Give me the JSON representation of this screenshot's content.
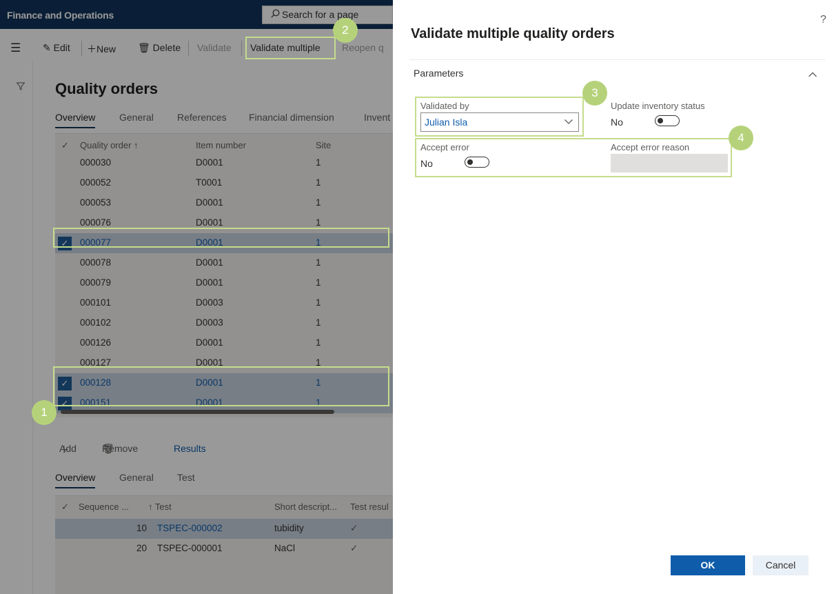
{
  "app": {
    "title": "Finance and Operations",
    "search_placeholder": "Search for a page"
  },
  "action_pane": {
    "edit": "Edit",
    "new": "New",
    "delete": "Delete",
    "validate": "Validate",
    "validate_multiple": "Validate multiple",
    "reopen": "Reopen q"
  },
  "page": {
    "title": "Quality orders",
    "tabs": [
      "Overview",
      "General",
      "References",
      "Financial dimension",
      "Invent"
    ]
  },
  "orders_grid": {
    "columns": [
      "Quality order ↑",
      "Item number",
      "Site"
    ],
    "rows": [
      {
        "order": "000030",
        "item": "D0001",
        "site": "1",
        "selected": false
      },
      {
        "order": "000052",
        "item": "T0001",
        "site": "1",
        "selected": false
      },
      {
        "order": "000053",
        "item": "D0001",
        "site": "1",
        "selected": false
      },
      {
        "order": "000076",
        "item": "D0001",
        "site": "1",
        "selected": false
      },
      {
        "order": "000077",
        "item": "D0001",
        "site": "1",
        "selected": true
      },
      {
        "order": "000078",
        "item": "D0001",
        "site": "1",
        "selected": false
      },
      {
        "order": "000079",
        "item": "D0001",
        "site": "1",
        "selected": false
      },
      {
        "order": "000101",
        "item": "D0003",
        "site": "1",
        "selected": false
      },
      {
        "order": "000102",
        "item": "D0003",
        "site": "1",
        "selected": false
      },
      {
        "order": "000126",
        "item": "D0001",
        "site": "1",
        "selected": false
      },
      {
        "order": "000127",
        "item": "D0001",
        "site": "1",
        "selected": false
      },
      {
        "order": "000128",
        "item": "D0001",
        "site": "1",
        "selected": true
      },
      {
        "order": "000151",
        "item": "D0001",
        "site": "1",
        "selected": true
      }
    ]
  },
  "lines_actions": {
    "add": "Add",
    "remove": "Remove",
    "results": "Results"
  },
  "lines_tabs": [
    "Overview",
    "General",
    "Test"
  ],
  "lines_grid": {
    "columns": [
      "Sequence ...",
      "↑ Test",
      "Short descript...",
      "Test resul"
    ],
    "rows": [
      {
        "seq": "10",
        "test": "TSPEC-000002",
        "desc": "tubidity",
        "result": "✓"
      },
      {
        "seq": "20",
        "test": "TSPEC-000001",
        "desc": "NaCl",
        "result": "✓"
      }
    ]
  },
  "dialog": {
    "title": "Validate multiple quality orders",
    "help": "?",
    "section": "Parameters",
    "validated_by_label": "Validated by",
    "validated_by_value": "Julian Isla",
    "update_inventory_label": "Update inventory status",
    "update_inventory_value": "No",
    "accept_error_label": "Accept error",
    "accept_error_value": "No",
    "accept_error_reason_label": "Accept error reason",
    "accept_error_reason_value": "",
    "ok": "OK",
    "cancel": "Cancel"
  },
  "callouts": [
    "1",
    "2",
    "3",
    "4"
  ],
  "colors": {
    "topbar": "#12345d",
    "primary_button": "#0f5cab",
    "callout": "#b5d27a",
    "highlight": "#c5dc8c"
  }
}
